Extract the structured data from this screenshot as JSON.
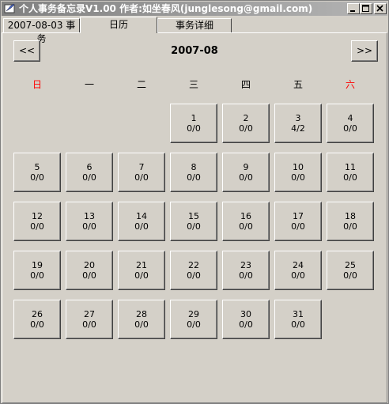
{
  "window": {
    "title": "个人事务备忘录V1.00 作者:如坐春风(junglesong@gmail.com)"
  },
  "tabs": [
    {
      "label": "2007-08-03 事务"
    },
    {
      "label": "日历"
    },
    {
      "label": "事务详细"
    }
  ],
  "calendar": {
    "prev_label": "<<",
    "next_label": ">>",
    "month": "2007-08",
    "weekdays": [
      {
        "label": "日",
        "weekend": true
      },
      {
        "label": "一",
        "weekend": false
      },
      {
        "label": "二",
        "weekend": false
      },
      {
        "label": "三",
        "weekend": false
      },
      {
        "label": "四",
        "weekend": false
      },
      {
        "label": "五",
        "weekend": false
      },
      {
        "label": "六",
        "weekend": true
      }
    ],
    "first_weekday_index": 3,
    "days": [
      {
        "day": "1",
        "count": "0/0"
      },
      {
        "day": "2",
        "count": "0/0"
      },
      {
        "day": "3",
        "count": "4/2"
      },
      {
        "day": "4",
        "count": "0/0"
      },
      {
        "day": "5",
        "count": "0/0"
      },
      {
        "day": "6",
        "count": "0/0"
      },
      {
        "day": "7",
        "count": "0/0"
      },
      {
        "day": "8",
        "count": "0/0"
      },
      {
        "day": "9",
        "count": "0/0"
      },
      {
        "day": "10",
        "count": "0/0"
      },
      {
        "day": "11",
        "count": "0/0"
      },
      {
        "day": "12",
        "count": "0/0"
      },
      {
        "day": "13",
        "count": "0/0"
      },
      {
        "day": "14",
        "count": "0/0"
      },
      {
        "day": "15",
        "count": "0/0"
      },
      {
        "day": "16",
        "count": "0/0"
      },
      {
        "day": "17",
        "count": "0/0"
      },
      {
        "day": "18",
        "count": "0/0"
      },
      {
        "day": "19",
        "count": "0/0"
      },
      {
        "day": "20",
        "count": "0/0"
      },
      {
        "day": "21",
        "count": "0/0"
      },
      {
        "day": "22",
        "count": "0/0"
      },
      {
        "day": "23",
        "count": "0/0"
      },
      {
        "day": "24",
        "count": "0/0"
      },
      {
        "day": "25",
        "count": "0/0"
      },
      {
        "day": "26",
        "count": "0/0"
      },
      {
        "day": "27",
        "count": "0/0"
      },
      {
        "day": "28",
        "count": "0/0"
      },
      {
        "day": "29",
        "count": "0/0"
      },
      {
        "day": "30",
        "count": "0/0"
      },
      {
        "day": "31",
        "count": "0/0"
      }
    ]
  },
  "colors": {
    "weekend": "#ff0000",
    "face": "#d4d0c8"
  },
  "icons": {
    "app": "app-icon",
    "minimize": "minimize-icon",
    "maximize": "maximize-icon",
    "close": "close-icon"
  }
}
